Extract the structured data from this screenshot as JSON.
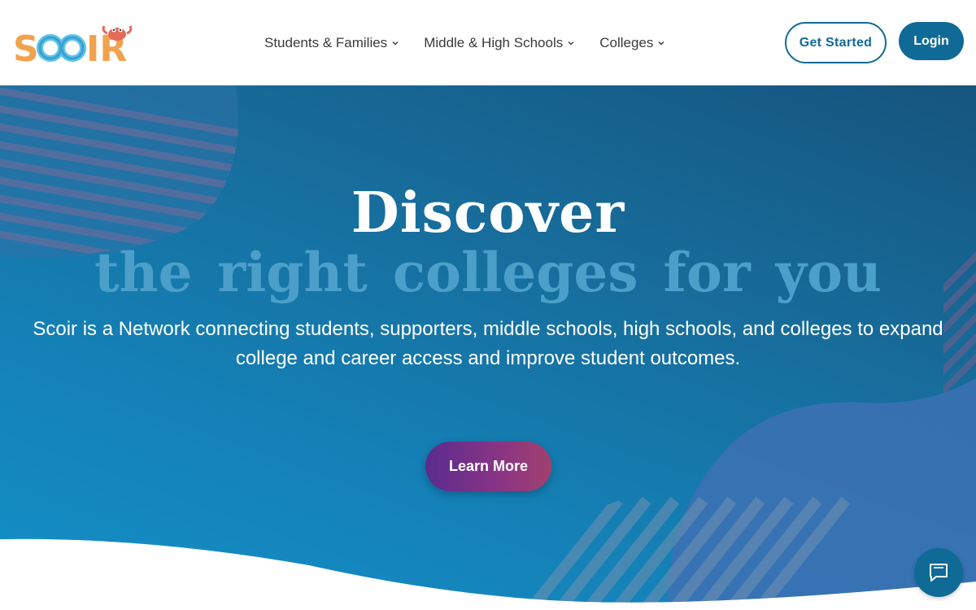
{
  "brand": {
    "logo_text": "SCOIR",
    "colors": {
      "primary": "#0f6a96",
      "logo_orange": "#f1a24e",
      "logo_blue": "#5cc3e8",
      "hero_highlight": "#4c9fc9"
    }
  },
  "nav": {
    "items": [
      {
        "label": "Students & Families",
        "icon": "chevron-down-icon"
      },
      {
        "label": "Middle & High Schools",
        "icon": "chevron-down-icon"
      },
      {
        "label": "Colleges",
        "icon": "chevron-down-icon"
      }
    ]
  },
  "header": {
    "get_started_label": "Get Started",
    "login_label": "Login"
  },
  "hero": {
    "title": "Discover",
    "subtitle": "the right colleges for you",
    "description": "Scoir is a Network connecting students, supporters, middle schools, high schools, and colleges to expand college and career access and improve student outcomes.",
    "cta_label": "Learn More"
  },
  "chat": {
    "icon": "chat-icon"
  }
}
